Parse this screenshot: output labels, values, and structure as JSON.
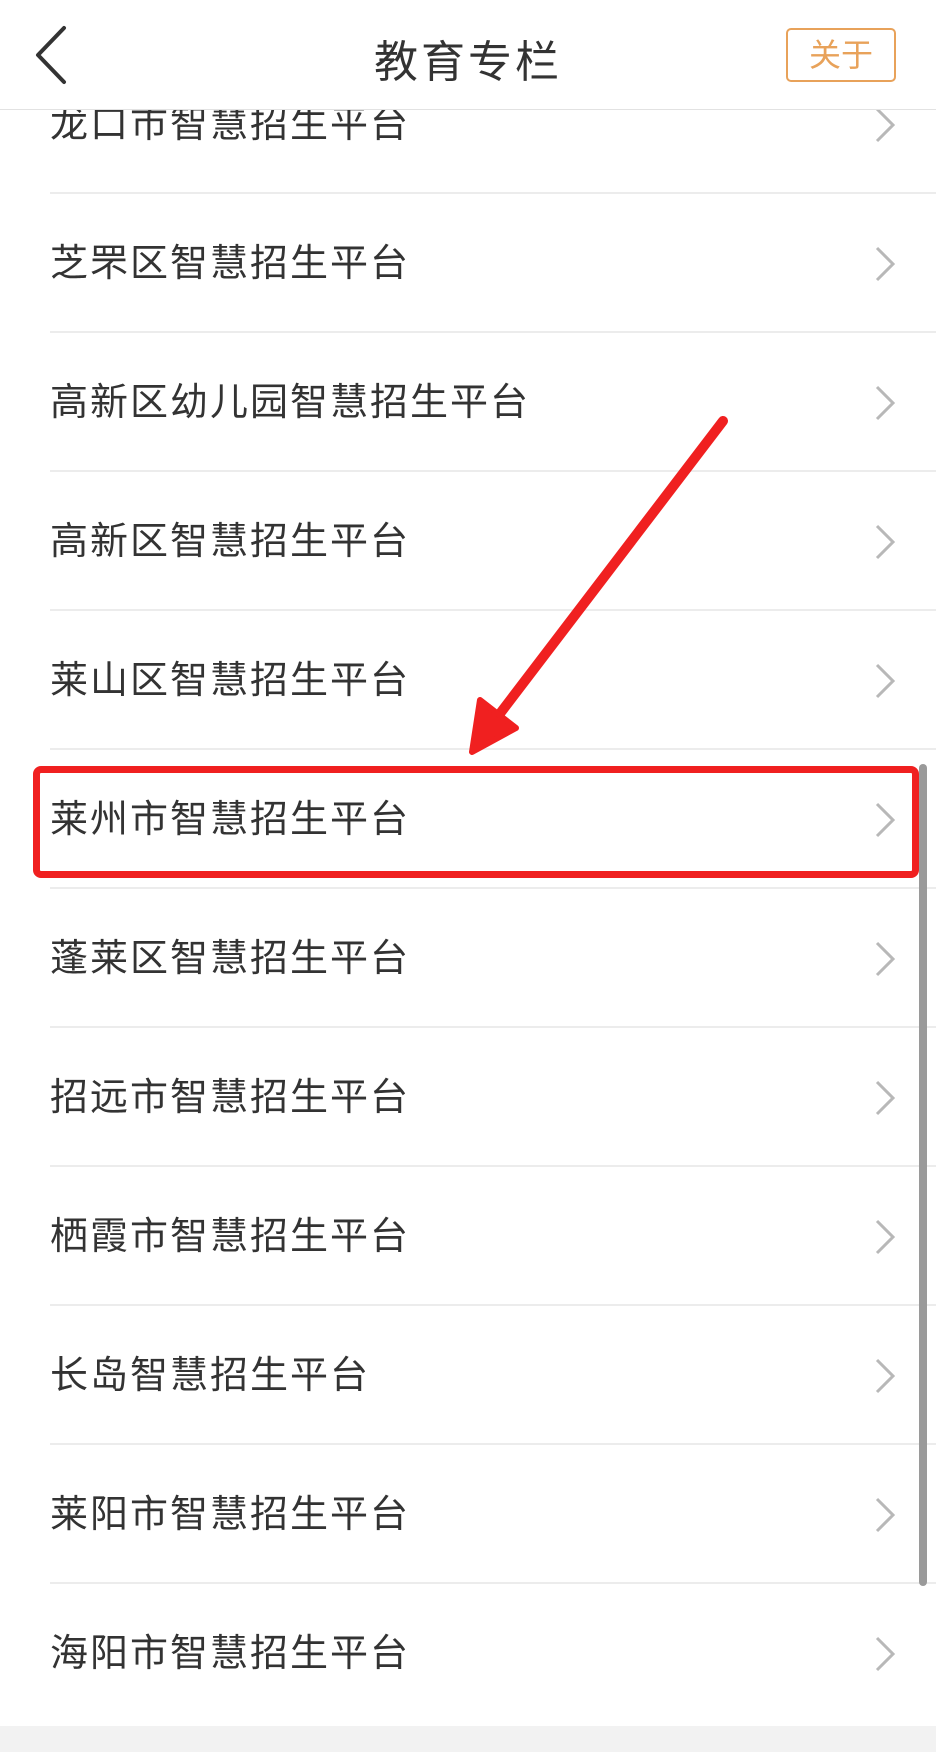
{
  "header": {
    "title": "教育专栏",
    "about_label": "关于"
  },
  "list": {
    "items": [
      {
        "label": "龙口市智慧招生平台"
      },
      {
        "label": "芝罘区智慧招生平台"
      },
      {
        "label": "高新区幼儿园智慧招生平台"
      },
      {
        "label": "高新区智慧招生平台"
      },
      {
        "label": "莱山区智慧招生平台"
      },
      {
        "label": "莱州市智慧招生平台"
      },
      {
        "label": "蓬莱区智慧招生平台"
      },
      {
        "label": "招远市智慧招生平台"
      },
      {
        "label": "栖霞市智慧招生平台"
      },
      {
        "label": "长岛智慧招生平台"
      },
      {
        "label": "莱阳市智慧招生平台"
      },
      {
        "label": "海阳市智慧招生平台"
      }
    ],
    "highlighted_item": "莱州市智慧招生平台"
  },
  "colors": {
    "accent": "#e8a25a",
    "highlight": "#f02020",
    "text": "#333333",
    "divider": "#ececec"
  },
  "icons": {
    "back": "chevron-left-icon",
    "row": "chevron-right-icon"
  }
}
